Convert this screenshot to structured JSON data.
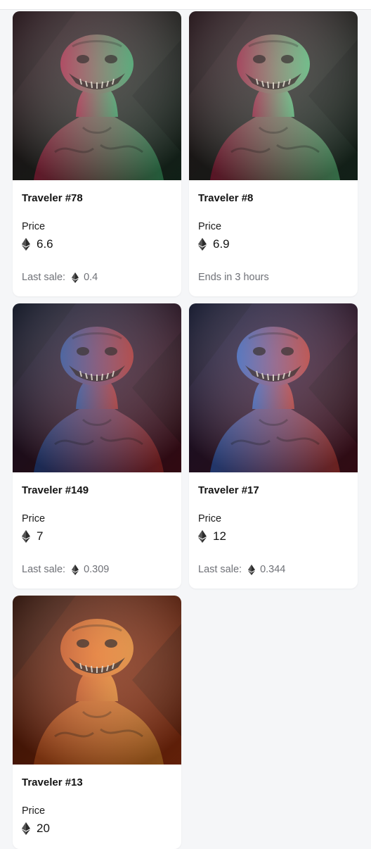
{
  "items": [
    {
      "name": "Traveler #78",
      "price_label": "Price",
      "price": "6.6",
      "footer_prefix": "Last sale:",
      "footer_value": "0.4",
      "theme": {
        "bg1": "#3a1a24",
        "bg2": "#1e3a2a",
        "left": "#b02a4a",
        "right": "#3fa86a"
      }
    },
    {
      "name": "Traveler #8",
      "price_label": "Price",
      "price": "6.9",
      "footer_prefix": "Ends in 3 hours",
      "footer_value": "",
      "theme": {
        "bg1": "#3a1a24",
        "bg2": "#1f3b2b",
        "left": "#a02443",
        "right": "#5cc27e"
      }
    },
    {
      "name": "Traveler #149",
      "price_label": "Price",
      "price": "7",
      "footer_prefix": "Last sale:",
      "footer_value": "0.309",
      "theme": {
        "bg1": "#121d3a",
        "bg2": "#5a1220",
        "left": "#2c4d9c",
        "right": "#b12d2d"
      }
    },
    {
      "name": "Traveler #17",
      "price_label": "Price",
      "price": "12",
      "footer_prefix": "Last sale:",
      "footer_value": "0.344",
      "theme": {
        "bg1": "#18204a",
        "bg2": "#5a1422",
        "left": "#3a64c4",
        "right": "#c23b37"
      }
    },
    {
      "name": "Traveler #13",
      "price_label": "Price",
      "price": "20",
      "footer_prefix": "",
      "footer_value": "",
      "theme": {
        "bg1": "#4a1606",
        "bg2": "#b23a10",
        "left": "#d3561c",
        "right": "#f08a2a"
      }
    }
  ]
}
